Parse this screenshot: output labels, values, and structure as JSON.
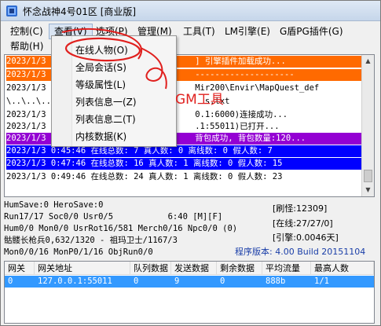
{
  "window": {
    "title": "怀念战神4号01区 [商业版]"
  },
  "menubar": {
    "items": [
      "控制(C)",
      "查看(V)",
      "选项(P)",
      "管理(M)",
      "工具(T)",
      "LM引擎(E)",
      "G盾PG插件(G)",
      "帮助(H)"
    ]
  },
  "dropdown": {
    "items": [
      "在线人物(O)",
      "全局会话(S)",
      "等级属性(L)",
      "列表信息一(Z)",
      "列表信息二(T)",
      "内核数据(K)"
    ]
  },
  "log": {
    "lines": [
      {
        "text": "2023/1/3                              ] 引擎插件加载成功...",
        "bg": "#ff6a00",
        "fg": "#ffffff"
      },
      {
        "text": "2023/1/3                              --------------------",
        "bg": "#ff6a00",
        "fg": "#ffffff"
      },
      {
        "text": "2023/1/3                              Mir200\\Envir\\MapQuest_def",
        "bg": "",
        "fg": "#000000"
      },
      {
        "text": "\\..\\..\\..                               s.txt",
        "bg": "",
        "fg": "#000000"
      },
      {
        "text": "2023/1/3                              0.1:6000)连接成功...",
        "bg": "",
        "fg": "#000000"
      },
      {
        "text": "2023/1/3                              .1:55011)已打开...",
        "bg": "",
        "fg": "#000000"
      },
      {
        "text": "2023/1/3                              背包成功, 背包数量:120...",
        "bg": "#9400d3",
        "fg": "#ffffff"
      },
      {
        "text": "2023/1/3 0:45:46 在线总数: 7 真人数: 0 离线数: 0 假人数: 7",
        "bg": "#0000ff",
        "fg": "#ffffff"
      },
      {
        "text": "2023/1/3 0:47:46 在线总数: 16 真人数: 1 离线数: 0 假人数: 15",
        "bg": "#0000ff",
        "fg": "#ffffff"
      },
      {
        "text": "2023/1/3 0:49:46 在线总数: 24 真人数: 1 离线数: 0 假人数: 23",
        "bg": "",
        "fg": "#000000"
      }
    ]
  },
  "status": {
    "lines": [
      "HumSave:0 HeroSave:0",
      "Run17/17 Soc0/0 Usr0/5           6:40 [M][F]",
      "Hum0/0 Mon0/0 UsrRot16/581 Merch0/16 Npc0/0 (0)",
      "骷髅长枪兵0,632/1320 - 祖玛卫士/1167/3",
      "Mon0/0/16 MonP0/1/16 ObjRun0/0"
    ],
    "refresh": "[刷怪:12309]",
    "online": "[在线:27/27/0]",
    "engine": "[引擎:0.0046天]",
    "version": "程序版本: 4.00 Build 20151104"
  },
  "table": {
    "headers": [
      "网关",
      "网关地址",
      "队列数据",
      "发送数据",
      "剩余数据",
      "平均流量",
      "最高人数"
    ],
    "rows": [
      [
        "0",
        "127.0.0.1:55011",
        "0",
        "9",
        "0",
        "888b",
        "1/1"
      ]
    ]
  },
  "annotation": {
    "text": "GM工具"
  },
  "colors": {
    "orange_log": "#ff6a00",
    "purple_log": "#9400d3",
    "blue_log": "#0000ff",
    "selection": "#3399ff",
    "annotation_red": "#e0201e"
  }
}
